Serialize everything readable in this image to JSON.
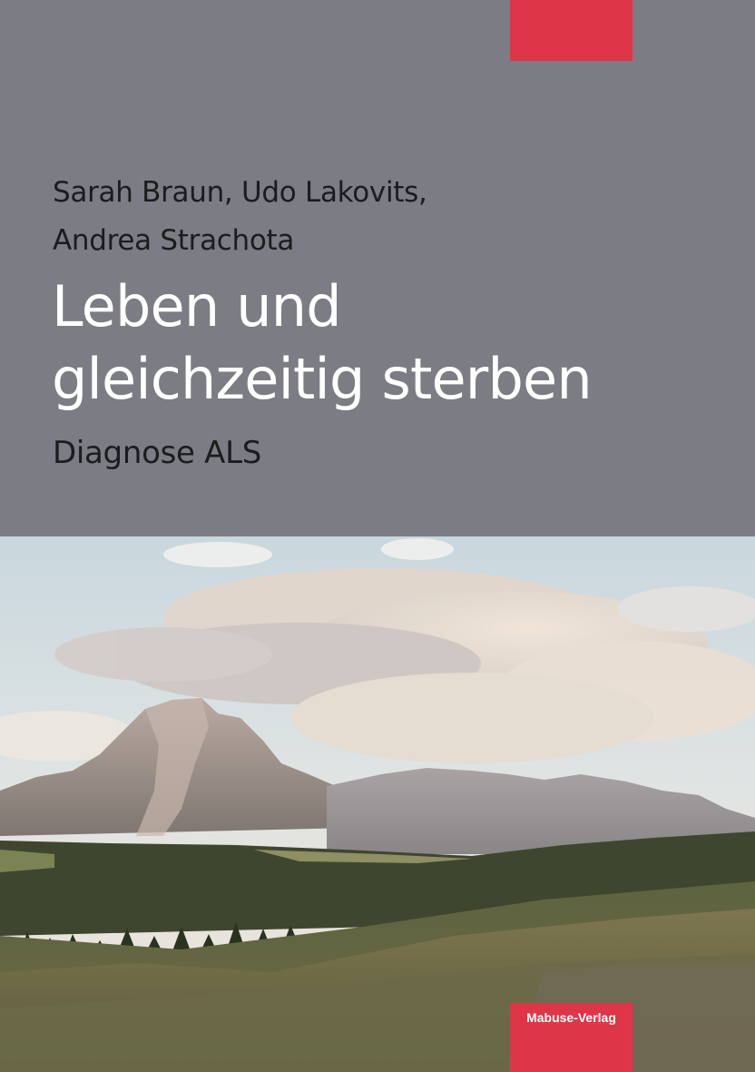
{
  "cover": {
    "authors_line1": "Sarah Braun, Udo Lakovits,",
    "authors_line2": "Andrea Strachota",
    "title_line1": "Leben und",
    "title_line2": "gleichzeitig sterben",
    "subtitle": "Diagnose ALS",
    "publisher": "Mabuse-Verlag"
  },
  "colors": {
    "background": "#7b7c84",
    "accent": "#de3648",
    "title": "#ffffff",
    "text": "#1c1c1e"
  }
}
